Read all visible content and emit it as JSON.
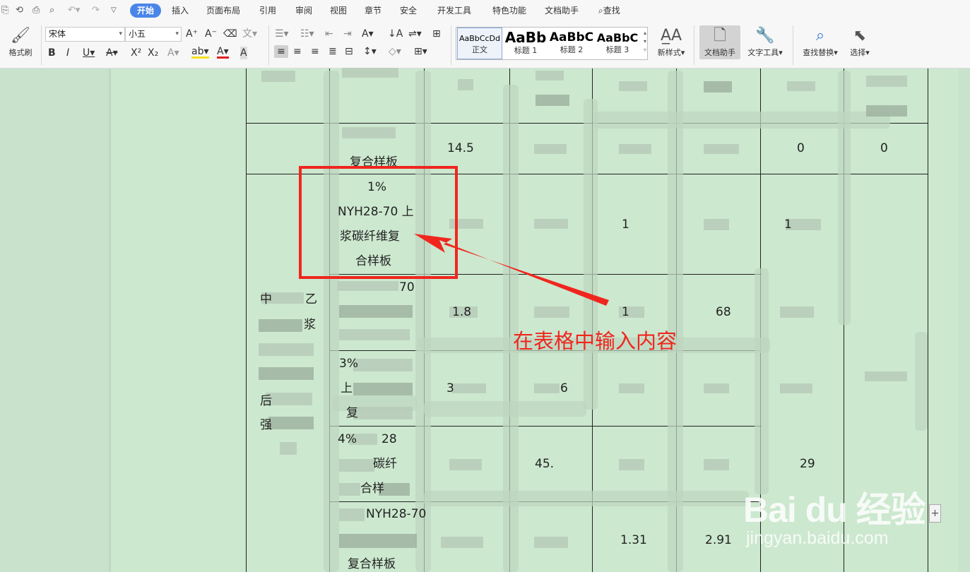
{
  "ribbon": {
    "menu": [
      {
        "label": "开始",
        "active": true
      },
      {
        "label": "插入"
      },
      {
        "label": "页面布局"
      },
      {
        "label": "引用"
      },
      {
        "label": "审阅"
      },
      {
        "label": "视图"
      },
      {
        "label": "章节"
      },
      {
        "label": "安全"
      },
      {
        "label": "开发工具"
      },
      {
        "label": "特色功能"
      },
      {
        "label": "文档助手"
      },
      {
        "label": "查找"
      }
    ],
    "format_painter": "格式刷",
    "font_name": "宋体",
    "font_size": "小五",
    "styles": [
      {
        "preview": "AaBbCcDd",
        "label": "正文"
      },
      {
        "preview": "AaBb",
        "label": "标题 1"
      },
      {
        "preview": "AaBbC",
        "label": "标题 2"
      },
      {
        "preview": "AaBbC",
        "label": "标题 3"
      }
    ],
    "new_style": "新样式",
    "doc_assistant": "文档助手",
    "text_tools": "文字工具",
    "find_replace": "查找替换",
    "select": "选择"
  },
  "table": {
    "cells": {
      "r1_c6_a": "14.5",
      "r1_c6_b": "复合样板",
      "r1_c8": "0",
      "r1_c9": "0",
      "hl_line1": "1%",
      "hl_line2": "NYH28-70 上",
      "hl_line3": "浆碳纤维复",
      "hl_line4": "合样板",
      "c70": "70",
      "v1_8": "1.8",
      "v68": "68",
      "left_1": "乙",
      "left_2": "浆",
      "r3_a": "3%",
      "r3_b": "上",
      "r3_c": "复",
      "v3": "3",
      "v6": "6",
      "left_3": "后",
      "left_4": "强",
      "r4_a": "4%",
      "r4_b": "28",
      "r4_c": "碳纤",
      "r4_d": "合样",
      "v45": "45.",
      "v29": "29",
      "r5_a": "NYH28-70",
      "r5_b": "复合样板",
      "v131": "1.31",
      "v291": "2.91"
    }
  },
  "annotation": "在表格中输入内容",
  "watermark": {
    "brand": "Bai du 经验",
    "site": "jingyan.baidu.com"
  }
}
